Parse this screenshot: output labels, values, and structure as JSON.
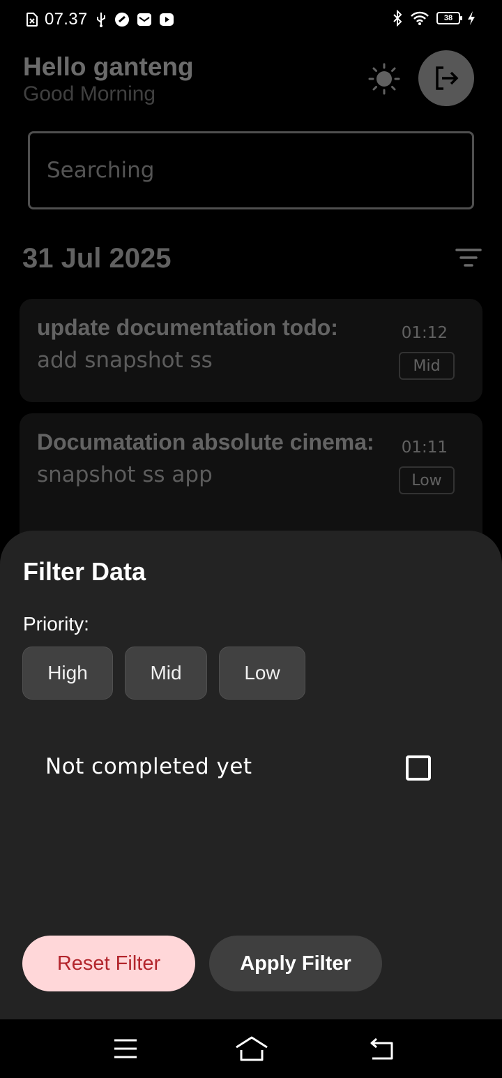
{
  "status_bar": {
    "time": "07.37",
    "battery": "38",
    "icons": [
      "sim-icon",
      "usb-icon",
      "app-icon",
      "mail-icon",
      "youtube-icon",
      "bluetooth-icon",
      "wifi-icon",
      "battery-icon",
      "charging-icon"
    ]
  },
  "header": {
    "greeting": "Hello ganteng",
    "subtitle": "Good Morning",
    "theme_icon": "sun-icon",
    "logout_icon": "logout-icon"
  },
  "search": {
    "placeholder": "Searching"
  },
  "list": {
    "date": "31 Jul 2025",
    "filter_icon": "filter-icon",
    "items": [
      {
        "title": "update documentation todo:",
        "description": "add snapshot ss",
        "time": "01:12",
        "priority": "Mid"
      },
      {
        "title": "Documatation absolute cinema:",
        "description": "snapshot ss app",
        "time": "01:11",
        "priority": "Low"
      }
    ]
  },
  "filter_sheet": {
    "title": "Filter Data",
    "priority_label": "Priority:",
    "priorities": [
      "High",
      "Mid",
      "Low"
    ],
    "not_completed_label": "Not completed yet",
    "not_completed_checked": false,
    "reset_label": "Reset Filter",
    "apply_label": "Apply Filter"
  },
  "colors": {
    "background": "#000000",
    "sheet": "#232323",
    "card": "#2a2a2a",
    "chip": "#414141",
    "reset_bg": "#ffd7d9",
    "reset_text": "#b3262d",
    "apply_bg": "#3f3f3f"
  },
  "nav_bar": {
    "icons": [
      "menu-icon",
      "home-icon",
      "back-icon"
    ]
  }
}
